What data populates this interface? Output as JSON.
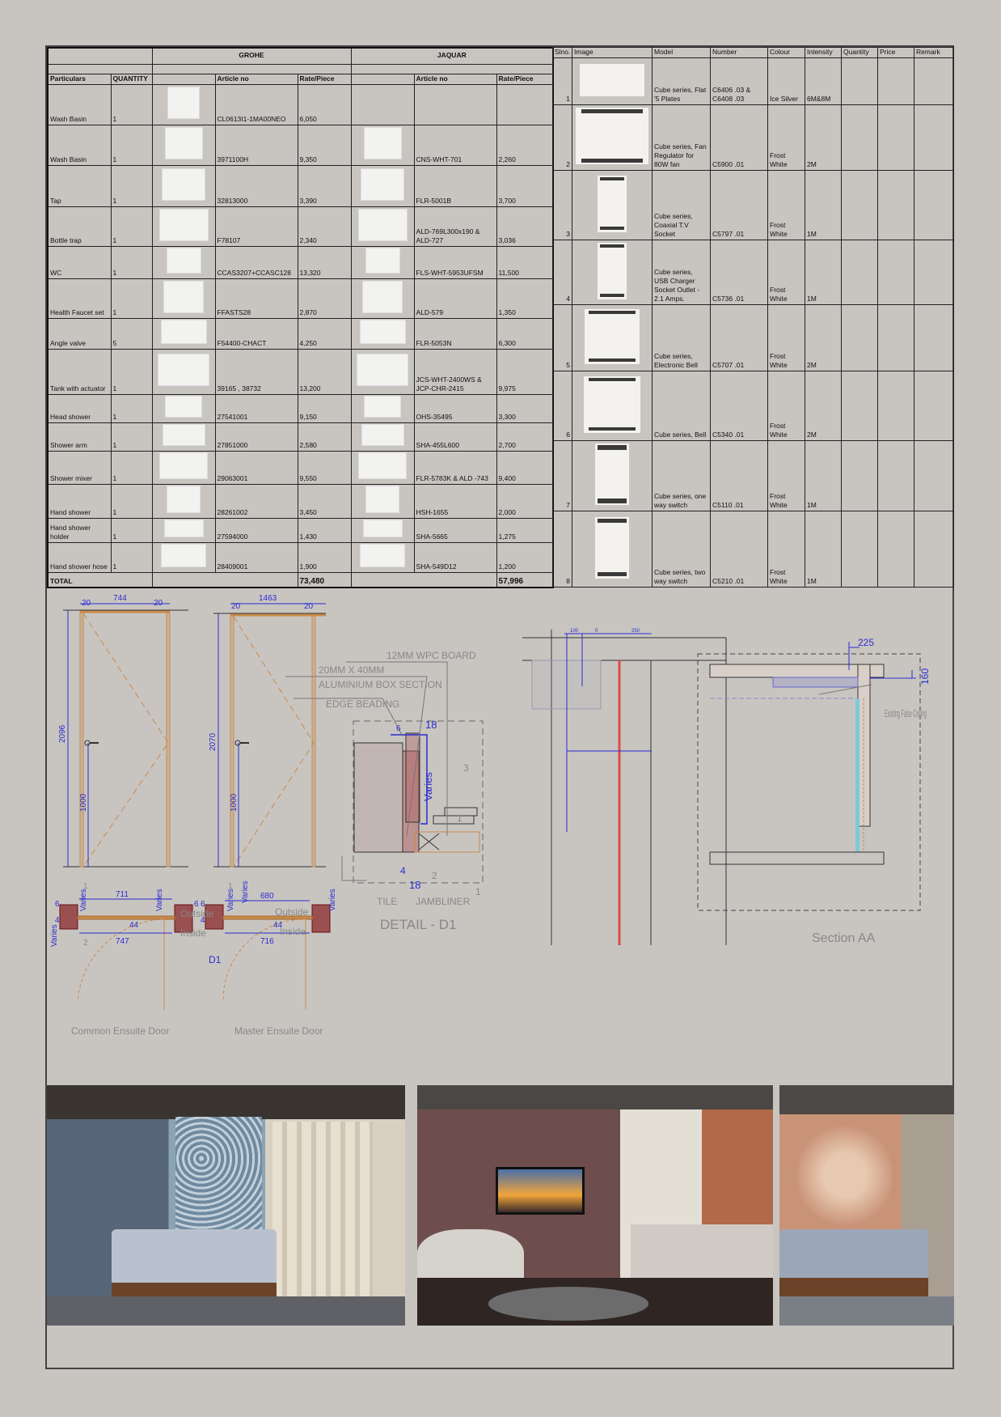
{
  "sanitary_table": {
    "brands": [
      "GROHE",
      "JAQUAR"
    ],
    "headers": {
      "particulars": "Particulars",
      "quantity": "QUANTITY",
      "article": "Article no",
      "rate": "Rate/Piece"
    },
    "rows": [
      {
        "item": "Wash Basin",
        "qty": "1",
        "grohe_article": "CL0613I1-1MA00NEO",
        "grohe_rate": "6,050",
        "jaquar_article": "",
        "jaquar_rate": ""
      },
      {
        "item": "Wash Basin",
        "qty": "1",
        "grohe_article": "3971100H",
        "grohe_rate": "9,350",
        "jaquar_article": "CNS-WHT-701",
        "jaquar_rate": "2,260"
      },
      {
        "item": "Tap",
        "qty": "1",
        "grohe_article": "32813000",
        "grohe_rate": "3,390",
        "jaquar_article": "FLR-5001B",
        "jaquar_rate": "3,700"
      },
      {
        "item": "Bottle trap",
        "qty": "1",
        "grohe_article": "F78107",
        "grohe_rate": "2,340",
        "jaquar_article": "ALD-769L300x190 & ALD-727",
        "jaquar_rate": "3,036"
      },
      {
        "item": "WC",
        "qty": "1",
        "grohe_article": "CCAS3207+CCASC128",
        "grohe_rate": "13,320",
        "jaquar_article": "FLS-WHT-5953UFSM",
        "jaquar_rate": "11,500"
      },
      {
        "item": "Health Faucet set",
        "qty": "1",
        "grohe_article": "FFASTS28",
        "grohe_rate": "2,870",
        "jaquar_article": "ALD-579",
        "jaquar_rate": "1,350"
      },
      {
        "item": "Angle valve",
        "qty": "5",
        "grohe_article": "F54400-CHACT",
        "grohe_rate": "4,250",
        "jaquar_article": "FLR-5053N",
        "jaquar_rate": "6,300"
      },
      {
        "item": "Tank with actuator",
        "qty": "1",
        "grohe_article": "39165 , 38732",
        "grohe_rate": "13,200",
        "jaquar_article": "JCS-WHT-2400WS & JCP-CHR-2415",
        "jaquar_rate": "9,975"
      },
      {
        "item": "Head shower",
        "qty": "1",
        "grohe_article": "27541001",
        "grohe_rate": "9,150",
        "jaquar_article": "OHS-35495",
        "jaquar_rate": "3,300"
      },
      {
        "item": "Shower arm",
        "qty": "1",
        "grohe_article": "27851000",
        "grohe_rate": "2,580",
        "jaquar_article": "SHA-455L600",
        "jaquar_rate": "2,700"
      },
      {
        "item": "Shower mixer",
        "qty": "1",
        "grohe_article": "29063001",
        "grohe_rate": "9,550",
        "jaquar_article": "FLR-5783K & ALD -743",
        "jaquar_rate": "9,400"
      },
      {
        "item": "Hand shower",
        "qty": "1",
        "grohe_article": "28261002",
        "grohe_rate": "3,450",
        "jaquar_article": "HSH-1655",
        "jaquar_rate": "2,000"
      },
      {
        "item": "Hand shower holder",
        "qty": "1",
        "grohe_article": "27594000",
        "grohe_rate": "1,430",
        "jaquar_article": "SHA-5665",
        "jaquar_rate": "1,275"
      },
      {
        "item": "Hand shower hose",
        "qty": "1",
        "grohe_article": "28409001",
        "grohe_rate": "1,900",
        "jaquar_article": "SHA-549D12",
        "jaquar_rate": "1,200"
      }
    ],
    "total_label": "TOTAL",
    "grohe_total": "73,480",
    "jaquar_total": "57,996"
  },
  "electrical_table": {
    "headers": [
      "Slno.",
      "Image",
      "Model",
      "Number",
      "Colour",
      "Intensity",
      "Quantity",
      "Price",
      "Remark"
    ],
    "rows": [
      {
        "sl": "1",
        "model": "Cube series, Flat '5 Plates",
        "number": "C6406 .03 & C6408 .03",
        "colour": "Ice Silver",
        "intensity": "6M&8M"
      },
      {
        "sl": "2",
        "model": "Cube series, Fan Regulator for 80W fan",
        "number": "C5900 .01",
        "colour": "Frost White",
        "intensity": "2M"
      },
      {
        "sl": "3",
        "model": "Cube series, Coaxial T.V Socket",
        "number": "C5797 .01",
        "colour": "Frost White",
        "intensity": "1M"
      },
      {
        "sl": "4",
        "model": "Cube series, USB Charger Socket Outlet - 2.1 Amps.",
        "number": "C5736 .01",
        "colour": "Frost White",
        "intensity": "1M"
      },
      {
        "sl": "5",
        "model": "Cube series, Electronic Bell",
        "number": "C5707 .01",
        "colour": "Frost White",
        "intensity": "2M"
      },
      {
        "sl": "6",
        "model": "Cube series, Bell",
        "number": "C5340 .01",
        "colour": "Frost White",
        "intensity": "2M"
      },
      {
        "sl": "7",
        "model": "Cube series, one way switch",
        "number": "C5110 .01",
        "colour": "Frost White",
        "intensity": "1M"
      },
      {
        "sl": "8",
        "model": "Cube series, two way switch",
        "number": "C5210 .01",
        "colour": "Frost White",
        "intensity": "1M"
      }
    ]
  },
  "drawings": {
    "common_door": {
      "title": "Common Ensuite Door",
      "width": "744",
      "height": "2096",
      "frame": "20",
      "handle": "1000",
      "clear": "711",
      "overall": "747",
      "varies": "Varies",
      "outside": "Outside",
      "inside": "Inside",
      "d6": "6",
      "d4": "4",
      "d44": "44",
      "tag": "1",
      "tag2": "2"
    },
    "master_door": {
      "title": "Master Ensuite Door",
      "width": "1463",
      "height": "2070",
      "frame": "20",
      "handle": "1000",
      "clear": "680",
      "overall": "716",
      "varies": "Varies",
      "outside": "Outside",
      "inside": "Inside",
      "d6": "6",
      "d4": "4",
      "d44": "44",
      "tag": "1",
      "key": "D1"
    },
    "detail_d1": {
      "title": "DETAIL - D1",
      "labels": [
        "12MM WPC BOARD",
        "20MM X 40MM",
        "ALUMINIUM BOX SECTION",
        "EDGE BEADING",
        "TILE",
        "JAMBLINER"
      ],
      "dims": [
        "6",
        "18",
        "Varies",
        "4",
        "18"
      ],
      "tags": [
        "3",
        "1",
        "2",
        "1"
      ]
    },
    "ac_detail": {
      "dims": [
        "100",
        "0",
        "250"
      ]
    },
    "section_aa": {
      "title": "Section AA",
      "label": "Existing False Ceiling",
      "dims": [
        "225",
        "160"
      ]
    }
  },
  "colors": {
    "background": "#c8c5c1",
    "dimension": "#2b2bd0",
    "door_frame": "#c98a4b",
    "wall_hatch": "#8a2a2a"
  }
}
